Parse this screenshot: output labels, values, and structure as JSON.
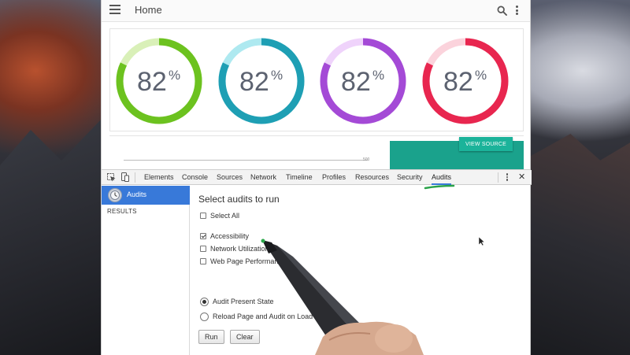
{
  "page": {
    "title": "Home",
    "gauges": [
      {
        "value": "82",
        "unit": "%",
        "percent": 82,
        "color": "#6cc21f",
        "track": "#d9f0b8"
      },
      {
        "value": "82",
        "unit": "%",
        "percent": 82,
        "color": "#1e9fb4",
        "track": "#aee9f0"
      },
      {
        "value": "82",
        "unit": "%",
        "percent": 82,
        "color": "#a44ad6",
        "track": "#efd3fb"
      },
      {
        "value": "82",
        "unit": "%",
        "percent": 82,
        "color": "#e8264f",
        "track": "#fbd3dc"
      }
    ],
    "chart_tick": "500",
    "view_source_label": "VIEW SOURCE"
  },
  "devtools": {
    "tabs": [
      {
        "label": "Elements"
      },
      {
        "label": "Console"
      },
      {
        "label": "Sources"
      },
      {
        "label": "Network"
      },
      {
        "label": "Timeline"
      },
      {
        "label": "Profiles"
      },
      {
        "label": "Resources"
      },
      {
        "label": "Security"
      },
      {
        "label": "Audits",
        "active": true
      }
    ],
    "sidebar": {
      "audits_label": "Audits",
      "results_label": "RESULTS"
    },
    "main": {
      "heading": "Select audits to run",
      "select_all": "Select All",
      "audits": [
        {
          "label": "Accessibility",
          "checked": true
        },
        {
          "label": "Network Utilization",
          "checked": false
        },
        {
          "label": "Web Page Performance",
          "checked": false
        }
      ],
      "modes": [
        {
          "label": "Audit Present State",
          "selected": true
        },
        {
          "label": "Reload Page and Audit on Load",
          "selected": false
        }
      ],
      "run_label": "Run",
      "clear_label": "Clear"
    },
    "accent_color": "#3879d9"
  },
  "icons": [
    "menu-icon",
    "search-icon",
    "more-vert-icon",
    "inspect-element-icon",
    "device-mode-icon",
    "kebab-menu-icon",
    "close-icon",
    "audits-icon"
  ]
}
